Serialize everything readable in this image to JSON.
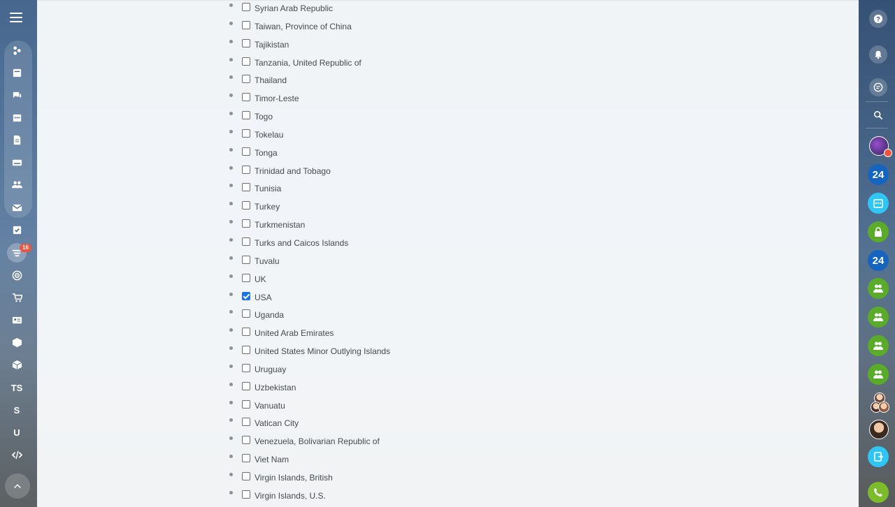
{
  "countries": [
    {
      "name": "Syrian Arab Republic",
      "checked": false
    },
    {
      "name": "Taiwan, Province of China",
      "checked": false
    },
    {
      "name": "Tajikistan",
      "checked": false
    },
    {
      "name": "Tanzania, United Republic of",
      "checked": false
    },
    {
      "name": "Thailand",
      "checked": false
    },
    {
      "name": "Timor-Leste",
      "checked": false
    },
    {
      "name": "Togo",
      "checked": false
    },
    {
      "name": "Tokelau",
      "checked": false
    },
    {
      "name": "Tonga",
      "checked": false
    },
    {
      "name": "Trinidad and Tobago",
      "checked": false
    },
    {
      "name": "Tunisia",
      "checked": false
    },
    {
      "name": "Turkey",
      "checked": false
    },
    {
      "name": "Turkmenistan",
      "checked": false
    },
    {
      "name": "Turks and Caicos Islands",
      "checked": false
    },
    {
      "name": "Tuvalu",
      "checked": false
    },
    {
      "name": "UK",
      "checked": false
    },
    {
      "name": "USA",
      "checked": true
    },
    {
      "name": "Uganda",
      "checked": false
    },
    {
      "name": "United Arab Emirates",
      "checked": false
    },
    {
      "name": "United States Minor Outlying Islands",
      "checked": false
    },
    {
      "name": "Uruguay",
      "checked": false
    },
    {
      "name": "Uzbekistan",
      "checked": false
    },
    {
      "name": "Vanuatu",
      "checked": false
    },
    {
      "name": "Vatican City",
      "checked": false
    },
    {
      "name": "Venezuela, Bolivarian Republic of",
      "checked": false
    },
    {
      "name": "Viet Nam",
      "checked": false
    },
    {
      "name": "Virgin Islands, British",
      "checked": false
    },
    {
      "name": "Virgin Islands, U.S.",
      "checked": false
    }
  ],
  "left_sidebar": {
    "menu_icon": "hamburger-icon",
    "items": [
      {
        "icon": "feed-icon"
      },
      {
        "icon": "tasks-icon"
      },
      {
        "icon": "chat-icon"
      },
      {
        "icon": "calendar-icon"
      },
      {
        "icon": "documents-icon"
      },
      {
        "icon": "drive-icon"
      },
      {
        "icon": "employees-icon"
      },
      {
        "icon": "mail-icon"
      },
      {
        "icon": "checklist-icon"
      },
      {
        "icon": "crm-filter-icon"
      },
      {
        "icon": "target-icon"
      },
      {
        "icon": "shop-cart-icon"
      },
      {
        "icon": "contact-card-icon"
      },
      {
        "icon": "box-icon"
      },
      {
        "icon": "cube-icon"
      }
    ],
    "filter_badge": "16",
    "text_items": [
      "TS",
      "S",
      "U"
    ],
    "code_icon": "code-icon"
  },
  "right_sidebar": {
    "help_icon": "help-icon",
    "notifications_icon": "bell-icon",
    "messages_icon": "messages-icon",
    "search_icon": "search-icon",
    "app_label_24": "24",
    "colors": {
      "blue": "#1565c0",
      "green": "#5aab2a",
      "teal": "#2fc6f6",
      "phone": "#7cbb2a"
    }
  }
}
